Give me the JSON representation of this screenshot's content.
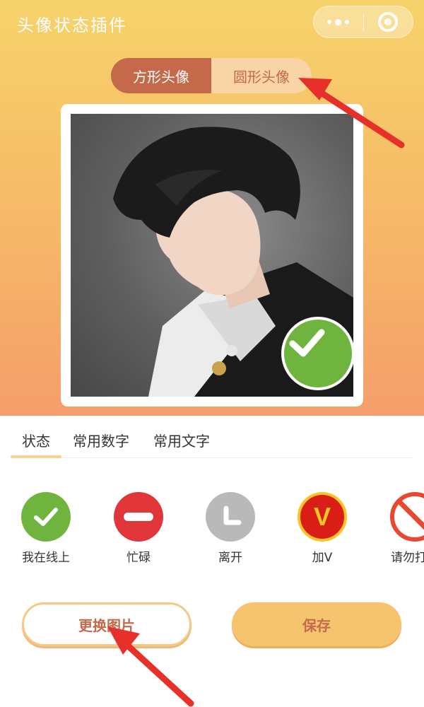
{
  "app": {
    "title": "头像状态插件"
  },
  "capsule": {
    "menu_icon": "more-dots-icon",
    "close_icon": "target-circle-icon"
  },
  "shape_toggle": {
    "options": [
      {
        "label": "方形头像",
        "selected": true
      },
      {
        "label": "圆形头像",
        "selected": false
      }
    ]
  },
  "preview": {
    "badge": "green-check-icon"
  },
  "tabs": [
    {
      "label": "状态",
      "active": true
    },
    {
      "label": "常用数字",
      "active": false
    },
    {
      "label": "常用文字",
      "active": false
    }
  ],
  "statuses": [
    {
      "label": "我在线上",
      "icon": "online-check-icon",
      "color": "#6fb43f"
    },
    {
      "label": "忙碌",
      "icon": "busy-minus-icon",
      "color": "#e0363a"
    },
    {
      "label": "离开",
      "icon": "away-clock-icon",
      "color": "#b9b9b9"
    },
    {
      "label": "加V",
      "icon": "verified-v-icon",
      "color": "#d81e16",
      "glyph": "V"
    },
    {
      "label": "请勿打扰",
      "icon": "do-not-disturb-icon",
      "color": "#e8482f"
    }
  ],
  "buttons": {
    "change_image": "更换图片",
    "save": "保存"
  },
  "colors": {
    "accent": "#c46a4a",
    "gradient_top": "#f7d36b",
    "gradient_bottom": "#f59e6a",
    "save_button": "#f6c46f",
    "annotation_arrow": "#e8302a"
  }
}
